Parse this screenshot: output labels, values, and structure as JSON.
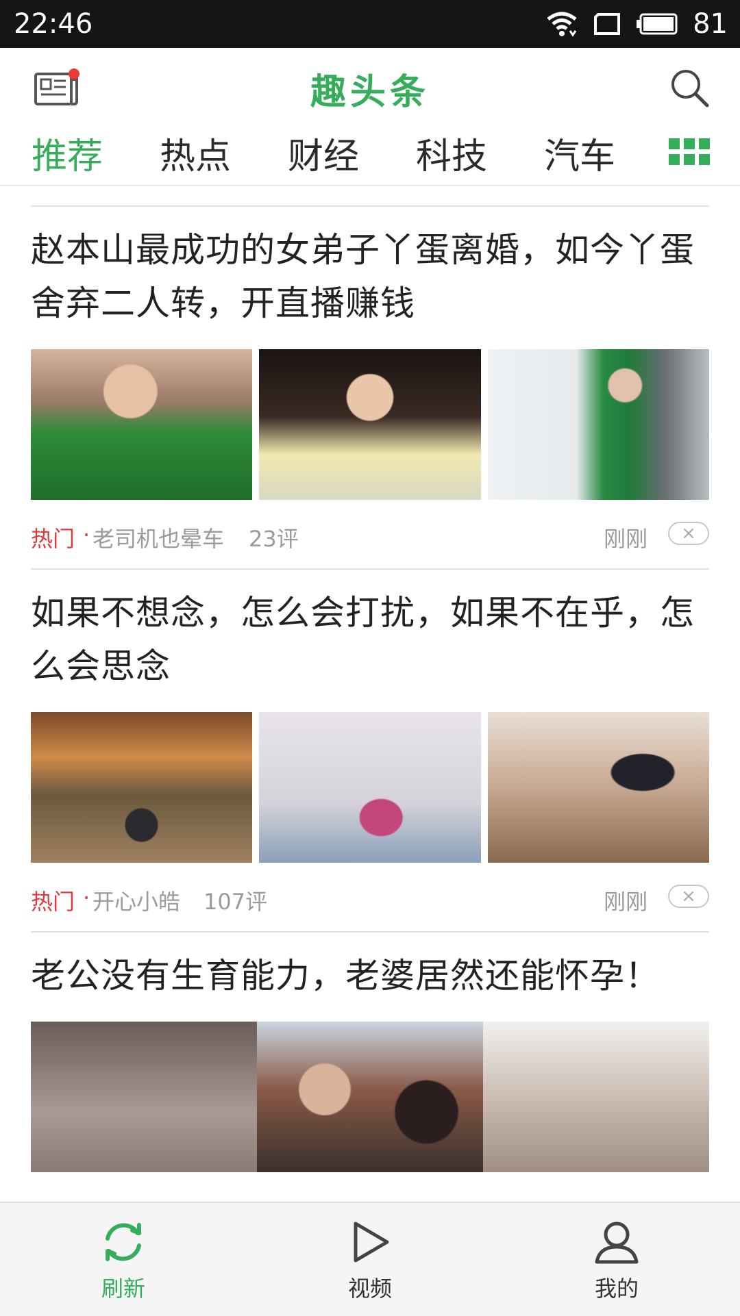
{
  "status": {
    "time": "22:46",
    "battery": "81"
  },
  "header": {
    "title": "趣头条"
  },
  "tabs": [
    "推荐",
    "热点",
    "财经",
    "科技",
    "汽车"
  ],
  "articles": [
    {
      "title": "赵本山最成功的女弟子丫蛋离婚，如今丫蛋舍弃二人转，开直播赚钱",
      "tag": "热门",
      "dot": "·",
      "source": "老司机也晕车",
      "comments": "23评",
      "time": "刚刚",
      "close": "×"
    },
    {
      "title": "如果不想念，怎么会打扰，如果不在乎，怎么会思念",
      "tag": "热门",
      "dot": "·",
      "source": "开心小皓",
      "comments": "107评",
      "time": "刚刚",
      "close": "×"
    },
    {
      "title": "老公没有生育能力，老婆居然还能怀孕！"
    }
  ],
  "nav": {
    "refresh": "刷新",
    "video": "视频",
    "mine": "我的"
  },
  "colors": {
    "brand_green": "#35ad5b",
    "hot_red": "#e23a3a",
    "status_bar": "#151513"
  },
  "icons": [
    "news-icon",
    "search-icon",
    "grid-menu-icon",
    "refresh-icon",
    "play-icon",
    "user-icon",
    "wifi-icon",
    "screen-icon",
    "battery-icon",
    "close-icon"
  ]
}
